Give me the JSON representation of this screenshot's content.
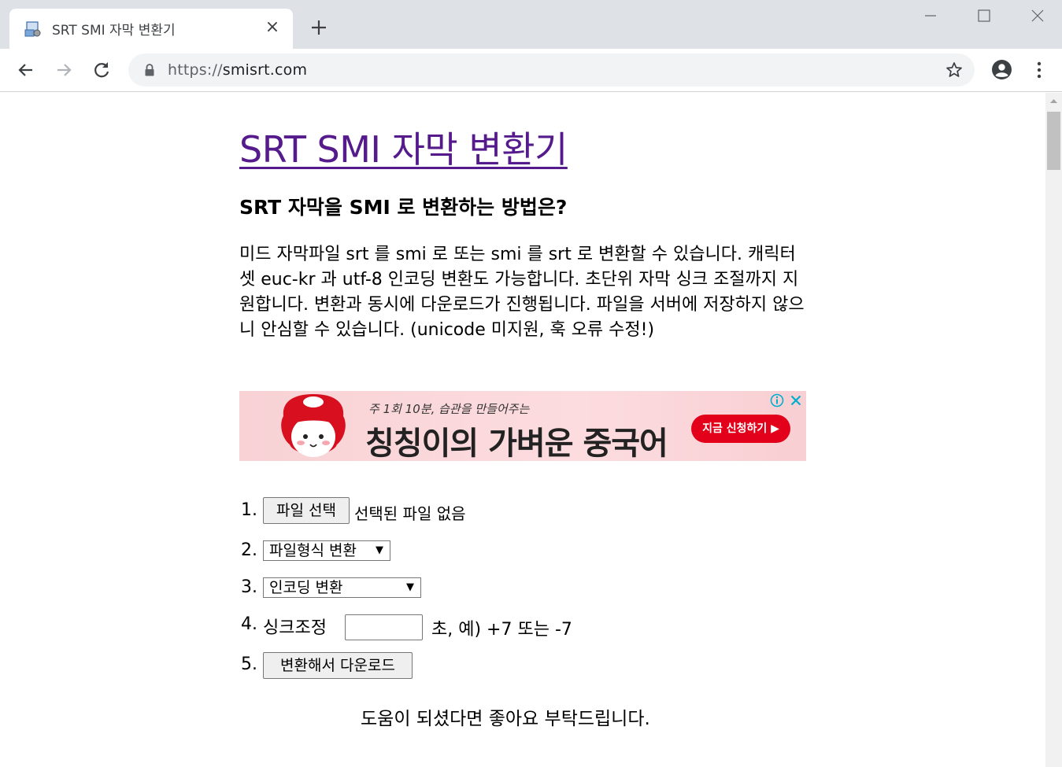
{
  "browser": {
    "tab_title": "SRT SMI 자막 변환기",
    "tab_close_glyph": "×",
    "url_scheme": "https://",
    "url_host": "smisrt.com"
  },
  "page": {
    "title": "SRT SMI 자막 변환기",
    "subtitle": "SRT 자막을 SMI 로 변환하는 방법은?",
    "description": "미드 자막파일 srt 를 smi 로 또는 smi 를 srt 로 변환할 수 있습니다. 캐릭터셋 euc-kr 과 utf-8 인코딩 변환도 가능합니다. 초단위 자막 싱크 조절까지 지원합니다. 변환과 동시에 다운로드가 진행됩니다. 파일을 서버에 저장하지 않으니 안심할 수 있습니다. (unicode 미지원, 훅 오류 수정!)"
  },
  "ad": {
    "small_text": "주 1회 10분, 습관을 만들어주는",
    "big_text": "칭칭이의 가벼운 중국어",
    "cta": "지금 신청하기 ▶"
  },
  "steps": [
    {
      "num": "1.",
      "button": "파일 선택",
      "status": "선택된 파일 없음"
    },
    {
      "num": "2.",
      "select": "파일형식 변환"
    },
    {
      "num": "3.",
      "select": "인코딩 변환"
    },
    {
      "num": "4.",
      "label": "싱크조정",
      "suffix": "초, 예) +7 또는 -7"
    },
    {
      "num": "5.",
      "button": "변환해서 다운로드"
    }
  ],
  "footer": "도움이 되셨다면 좋아요 부탁드립니다.",
  "colors": {
    "title_link": "#551a8b",
    "tabbar": "#dee1e6",
    "omnibox": "#f1f3f4",
    "ad_cta": "#e3001b"
  }
}
